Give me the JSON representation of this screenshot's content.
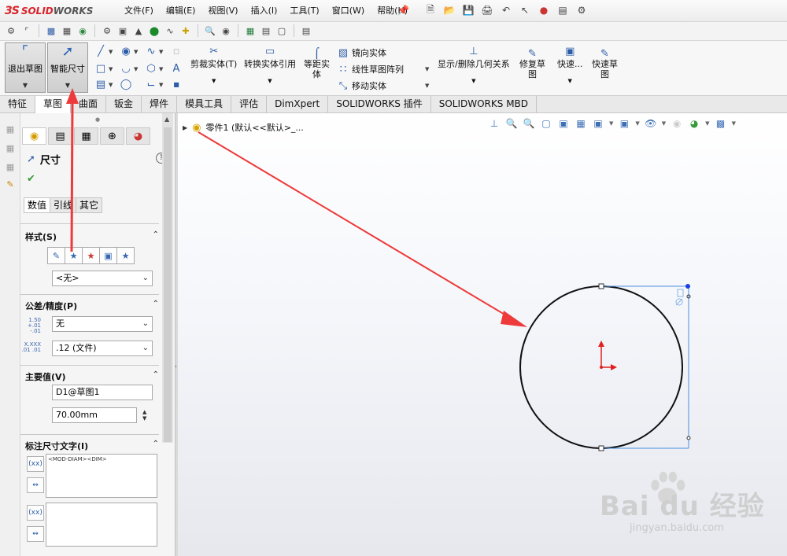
{
  "app": {
    "logo_ds": "3S",
    "logo_solid": "SOLID",
    "logo_works": "WORKS"
  },
  "menu": [
    "文件(F)",
    "编辑(E)",
    "视图(V)",
    "插入(I)",
    "工具(T)",
    "窗口(W)",
    "帮助(H)"
  ],
  "commandmanager": {
    "exit_sketch": "退出草图",
    "smart_dimension": "智能尺寸",
    "trim": "剪裁实体(T)",
    "convert": "转换实体引用",
    "offset_line1": "等距实",
    "offset_line2": "体",
    "mirror": "镜向实体",
    "linear_pattern": "线性草图阵列",
    "move": "移动实体",
    "show_relations": "显示/删除几何关系",
    "repair_line1": "修复草",
    "repair_line2": "图",
    "quick_snap": "快速...",
    "quick_sketch_line1": "快速草",
    "quick_sketch_line2": "图"
  },
  "tabs": [
    "特征",
    "草图",
    "曲面",
    "钣金",
    "焊件",
    "模具工具",
    "评估",
    "DimXpert",
    "SOLIDWORKS 插件",
    "SOLIDWORKS MBD"
  ],
  "active_tab": "草图",
  "property_manager": {
    "title": "尺寸",
    "subtabs": [
      "数值",
      "引线",
      "其它"
    ],
    "style_header": "样式(S)",
    "style_value": "<无>",
    "tolerance_header": "公差/精度(P)",
    "tolerance_icon_text": "1.50 +.01 -.01",
    "tolerance_value": "无",
    "precision_icon_text": "X.XXX .01 .01",
    "precision_value": ".12 (文件)",
    "primary_header": "主要值(V)",
    "primary_name": "D1@草图1",
    "primary_value": "70.00mm",
    "dimtext_header": "标注尺寸文字(I)",
    "dimtext_value": "<MOD-DIAM><DIM>",
    "xx_label": "(xx)"
  },
  "graphics": {
    "tree_label": "零件1 (默认<<默认>_..."
  },
  "watermark": {
    "brand": "Bai  du 经验",
    "url": "jingyan.baidu.com"
  },
  "colors": {
    "accent_red": "#d8232a",
    "sketch_blue": "#4a8fe0",
    "arrow_red": "#ee3a3a"
  }
}
